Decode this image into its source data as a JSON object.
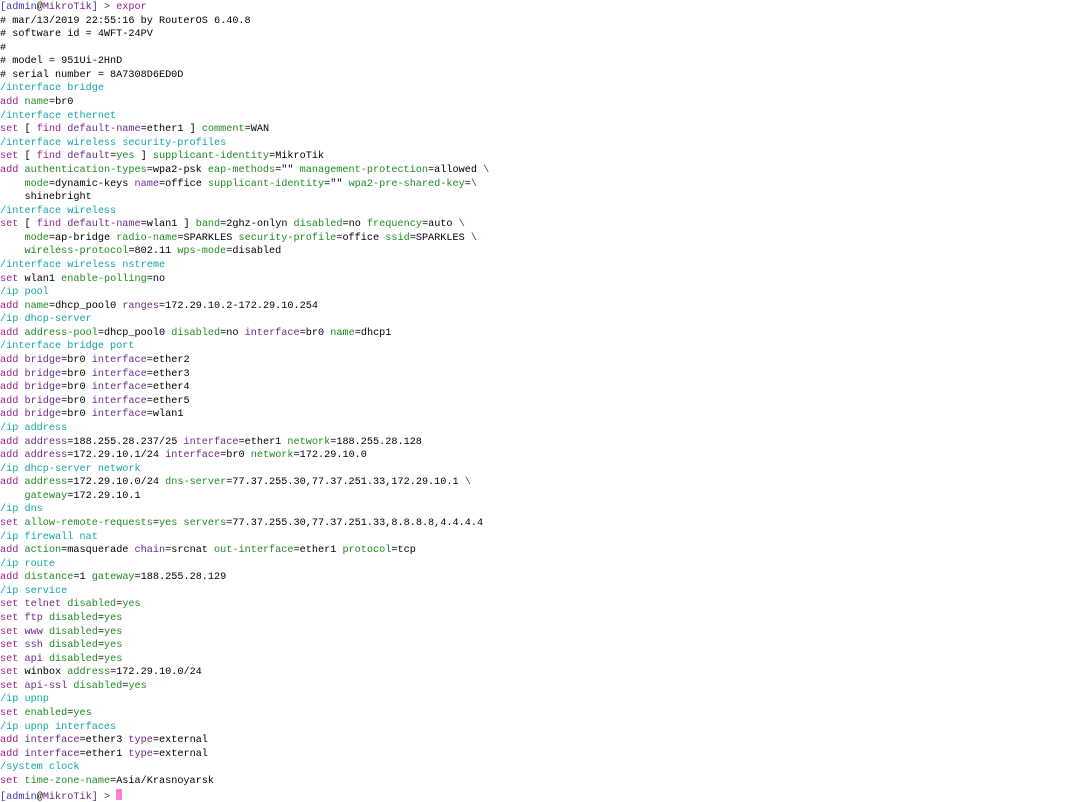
{
  "terminal": {
    "colors": {
      "default": "#000000",
      "prompt": "#3a3aa8",
      "identity": "#6b2a86",
      "path": "#15a5a5",
      "command": "#a0208a",
      "key": "#208a20",
      "keyword": "#6b2a86",
      "value": "#000000",
      "cursor": "#ff7fd0"
    },
    "lines": [
      [
        [
          "[admin",
          "prompt"
        ],
        [
          "@",
          "default"
        ],
        [
          "MikroTik",
          "identity"
        ],
        [
          "] > ",
          "prompt"
        ],
        [
          "expor",
          "command"
        ]
      ],
      [
        [
          "# mar/13/2019 22:55:16 by RouterOS 6.40.8",
          "default"
        ]
      ],
      [
        [
          "# software id = 4WFT-24PV",
          "default"
        ]
      ],
      [
        [
          "#",
          "default"
        ]
      ],
      [
        [
          "# model = 951Ui-2HnD",
          "default"
        ]
      ],
      [
        [
          "# serial number = 8A7308D6ED0D",
          "default"
        ]
      ],
      [
        [
          "/interface bridge",
          "path"
        ]
      ],
      [
        [
          "add ",
          "command"
        ],
        [
          "name",
          "key"
        ],
        [
          "=",
          "default"
        ],
        [
          "br0",
          "value"
        ]
      ],
      [
        [
          "/interface ethernet",
          "path"
        ]
      ],
      [
        [
          "set ",
          "command"
        ],
        [
          "[ ",
          "default"
        ],
        [
          "find ",
          "command"
        ],
        [
          "default-name",
          "keyword"
        ],
        [
          "=",
          "default"
        ],
        [
          "ether1",
          "value"
        ],
        [
          " ] ",
          "default"
        ],
        [
          "comment",
          "key"
        ],
        [
          "=",
          "default"
        ],
        [
          "WAN",
          "value"
        ]
      ],
      [
        [
          "/interface wireless security-profiles",
          "path"
        ]
      ],
      [
        [
          "set ",
          "command"
        ],
        [
          "[ ",
          "default"
        ],
        [
          "find ",
          "command"
        ],
        [
          "default",
          "keyword"
        ],
        [
          "=",
          "default"
        ],
        [
          "yes",
          "key"
        ],
        [
          " ] ",
          "default"
        ],
        [
          "supplicant-identity",
          "key"
        ],
        [
          "=",
          "default"
        ],
        [
          "MikroTik",
          "value"
        ]
      ],
      [
        [
          "add ",
          "command"
        ],
        [
          "authentication-types",
          "key"
        ],
        [
          "=",
          "default"
        ],
        [
          "wpa2-psk ",
          "value"
        ],
        [
          "eap-methods",
          "key"
        ],
        [
          "=\"\" ",
          "default"
        ],
        [
          "management-protection",
          "key"
        ],
        [
          "=",
          "default"
        ],
        [
          "allowed ",
          "value"
        ],
        [
          "\\",
          "keyword"
        ]
      ],
      [
        [
          "    mode",
          "key"
        ],
        [
          "=",
          "default"
        ],
        [
          "dynamic-keys ",
          "value"
        ],
        [
          "name",
          "keyword"
        ],
        [
          "=",
          "default"
        ],
        [
          "office ",
          "value"
        ],
        [
          "supplicant-identity",
          "key"
        ],
        [
          "=\"\" ",
          "default"
        ],
        [
          "wpa2-pre-shared-key",
          "key"
        ],
        [
          "=",
          "default"
        ],
        [
          "\\",
          "keyword"
        ]
      ],
      [
        [
          "    shinebright",
          "value"
        ]
      ],
      [
        [
          "/interface wireless",
          "path"
        ]
      ],
      [
        [
          "set ",
          "command"
        ],
        [
          "[ ",
          "default"
        ],
        [
          "find ",
          "command"
        ],
        [
          "default-name",
          "keyword"
        ],
        [
          "=",
          "default"
        ],
        [
          "wlan1",
          "value"
        ],
        [
          " ] ",
          "default"
        ],
        [
          "band",
          "key"
        ],
        [
          "=",
          "default"
        ],
        [
          "2ghz-onlyn ",
          "value"
        ],
        [
          "disabled",
          "key"
        ],
        [
          "=",
          "default"
        ],
        [
          "no ",
          "value"
        ],
        [
          "frequency",
          "key"
        ],
        [
          "=",
          "default"
        ],
        [
          "auto ",
          "value"
        ],
        [
          "\\",
          "keyword"
        ]
      ],
      [
        [
          "    mode",
          "key"
        ],
        [
          "=",
          "default"
        ],
        [
          "ap-bridge ",
          "value"
        ],
        [
          "radio-name",
          "key"
        ],
        [
          "=",
          "default"
        ],
        [
          "SPARKLES ",
          "value"
        ],
        [
          "security-profile",
          "key"
        ],
        [
          "=",
          "default"
        ],
        [
          "office ",
          "value"
        ],
        [
          "ssid",
          "key"
        ],
        [
          "=",
          "default"
        ],
        [
          "SPARKLES ",
          "value"
        ],
        [
          "\\",
          "keyword"
        ]
      ],
      [
        [
          "    wireless-protocol",
          "key"
        ],
        [
          "=",
          "default"
        ],
        [
          "802.11 ",
          "value"
        ],
        [
          "wps-mode",
          "key"
        ],
        [
          "=",
          "default"
        ],
        [
          "disabled",
          "value"
        ]
      ],
      [
        [
          "/interface wireless nstreme",
          "path"
        ]
      ],
      [
        [
          "set ",
          "command"
        ],
        [
          "wlan1 ",
          "value"
        ],
        [
          "enable-polling",
          "key"
        ],
        [
          "=",
          "default"
        ],
        [
          "no",
          "value"
        ]
      ],
      [
        [
          "/ip pool",
          "path"
        ]
      ],
      [
        [
          "add ",
          "command"
        ],
        [
          "name",
          "key"
        ],
        [
          "=",
          "default"
        ],
        [
          "dhcp_pool0 ",
          "value"
        ],
        [
          "ranges",
          "keyword"
        ],
        [
          "=",
          "default"
        ],
        [
          "172.29.10.2-172.29.10.254",
          "value"
        ]
      ],
      [
        [
          "/ip dhcp-server",
          "path"
        ]
      ],
      [
        [
          "add ",
          "command"
        ],
        [
          "address-pool",
          "key"
        ],
        [
          "=",
          "default"
        ],
        [
          "dhcp_pool0 ",
          "value"
        ],
        [
          "disabled",
          "key"
        ],
        [
          "=",
          "default"
        ],
        [
          "no ",
          "value"
        ],
        [
          "interface",
          "keyword"
        ],
        [
          "=",
          "default"
        ],
        [
          "br0 ",
          "value"
        ],
        [
          "name",
          "key"
        ],
        [
          "=",
          "default"
        ],
        [
          "dhcp1",
          "value"
        ]
      ],
      [
        [
          "/interface bridge port",
          "path"
        ]
      ],
      [
        [
          "add ",
          "command"
        ],
        [
          "bridge",
          "keyword"
        ],
        [
          "=",
          "default"
        ],
        [
          "br0 ",
          "value"
        ],
        [
          "interface",
          "keyword"
        ],
        [
          "=",
          "default"
        ],
        [
          "ether2",
          "value"
        ]
      ],
      [
        [
          "add ",
          "command"
        ],
        [
          "bridge",
          "keyword"
        ],
        [
          "=",
          "default"
        ],
        [
          "br0 ",
          "value"
        ],
        [
          "interface",
          "keyword"
        ],
        [
          "=",
          "default"
        ],
        [
          "ether3",
          "value"
        ]
      ],
      [
        [
          "add ",
          "command"
        ],
        [
          "bridge",
          "keyword"
        ],
        [
          "=",
          "default"
        ],
        [
          "br0 ",
          "value"
        ],
        [
          "interface",
          "keyword"
        ],
        [
          "=",
          "default"
        ],
        [
          "ether4",
          "value"
        ]
      ],
      [
        [
          "add ",
          "command"
        ],
        [
          "bridge",
          "keyword"
        ],
        [
          "=",
          "default"
        ],
        [
          "br0 ",
          "value"
        ],
        [
          "interface",
          "keyword"
        ],
        [
          "=",
          "default"
        ],
        [
          "ether5",
          "value"
        ]
      ],
      [
        [
          "add ",
          "command"
        ],
        [
          "bridge",
          "keyword"
        ],
        [
          "=",
          "default"
        ],
        [
          "br0 ",
          "value"
        ],
        [
          "interface",
          "keyword"
        ],
        [
          "=",
          "default"
        ],
        [
          "wlan1",
          "value"
        ]
      ],
      [
        [
          "/ip address",
          "path"
        ]
      ],
      [
        [
          "add ",
          "command"
        ],
        [
          "address",
          "keyword"
        ],
        [
          "=",
          "default"
        ],
        [
          "188.255.28.237",
          "value"
        ],
        [
          "/",
          "default"
        ],
        [
          "25 ",
          "value"
        ],
        [
          "interface",
          "keyword"
        ],
        [
          "=",
          "default"
        ],
        [
          "ether1 ",
          "value"
        ],
        [
          "network",
          "key"
        ],
        [
          "=",
          "default"
        ],
        [
          "188.255.28.128",
          "value"
        ]
      ],
      [
        [
          "add ",
          "command"
        ],
        [
          "address",
          "keyword"
        ],
        [
          "=",
          "default"
        ],
        [
          "172.29.10.1",
          "value"
        ],
        [
          "/",
          "default"
        ],
        [
          "24 ",
          "value"
        ],
        [
          "interface",
          "keyword"
        ],
        [
          "=",
          "default"
        ],
        [
          "br0 ",
          "value"
        ],
        [
          "network",
          "key"
        ],
        [
          "=",
          "default"
        ],
        [
          "172.29.10.0",
          "value"
        ]
      ],
      [
        [
          "/ip dhcp-server network",
          "path"
        ]
      ],
      [
        [
          "add ",
          "command"
        ],
        [
          "address",
          "key"
        ],
        [
          "=",
          "default"
        ],
        [
          "172.29.10.0",
          "value"
        ],
        [
          "/",
          "default"
        ],
        [
          "24 ",
          "value"
        ],
        [
          "dns-server",
          "key"
        ],
        [
          "=",
          "default"
        ],
        [
          "77.37.255.30",
          "value"
        ],
        [
          ",",
          "default"
        ],
        [
          "77.37.251.33",
          "value"
        ],
        [
          ",",
          "default"
        ],
        [
          "172.29.10.1 ",
          "value"
        ],
        [
          "\\",
          "keyword"
        ]
      ],
      [
        [
          "    gateway",
          "key"
        ],
        [
          "=",
          "default"
        ],
        [
          "172.29.10.1",
          "value"
        ]
      ],
      [
        [
          "/ip dns",
          "path"
        ]
      ],
      [
        [
          "set ",
          "command"
        ],
        [
          "allow-remote-requests",
          "key"
        ],
        [
          "=",
          "default"
        ],
        [
          "yes ",
          "key"
        ],
        [
          "servers",
          "key"
        ],
        [
          "=",
          "default"
        ],
        [
          "77.37.255.30",
          "value"
        ],
        [
          ",",
          "default"
        ],
        [
          "77.37.251.33",
          "value"
        ],
        [
          ",",
          "default"
        ],
        [
          "8.8.8.8",
          "value"
        ],
        [
          ",",
          "default"
        ],
        [
          "4.4.4.4",
          "value"
        ]
      ],
      [
        [
          "/ip firewall nat",
          "path"
        ]
      ],
      [
        [
          "add ",
          "command"
        ],
        [
          "action",
          "key"
        ],
        [
          "=",
          "default"
        ],
        [
          "masquerade ",
          "value"
        ],
        [
          "chain",
          "keyword"
        ],
        [
          "=",
          "default"
        ],
        [
          "srcnat ",
          "value"
        ],
        [
          "out-interface",
          "key"
        ],
        [
          "=",
          "default"
        ],
        [
          "ether1 ",
          "value"
        ],
        [
          "protocol",
          "key"
        ],
        [
          "=",
          "default"
        ],
        [
          "tcp",
          "value"
        ]
      ],
      [
        [
          "/ip route",
          "path"
        ]
      ],
      [
        [
          "add ",
          "command"
        ],
        [
          "distance",
          "key"
        ],
        [
          "=",
          "default"
        ],
        [
          "1 ",
          "value"
        ],
        [
          "gateway",
          "key"
        ],
        [
          "=",
          "default"
        ],
        [
          "188.255.28.129",
          "value"
        ]
      ],
      [
        [
          "/ip service",
          "path"
        ]
      ],
      [
        [
          "set ",
          "command"
        ],
        [
          "telnet ",
          "keyword"
        ],
        [
          "disabled",
          "key"
        ],
        [
          "=",
          "default"
        ],
        [
          "yes",
          "key"
        ]
      ],
      [
        [
          "set ",
          "command"
        ],
        [
          "ftp ",
          "keyword"
        ],
        [
          "disabled",
          "key"
        ],
        [
          "=",
          "default"
        ],
        [
          "yes",
          "key"
        ]
      ],
      [
        [
          "set ",
          "command"
        ],
        [
          "www ",
          "keyword"
        ],
        [
          "disabled",
          "key"
        ],
        [
          "=",
          "default"
        ],
        [
          "yes",
          "key"
        ]
      ],
      [
        [
          "set ",
          "command"
        ],
        [
          "ssh ",
          "keyword"
        ],
        [
          "disabled",
          "key"
        ],
        [
          "=",
          "default"
        ],
        [
          "yes",
          "key"
        ]
      ],
      [
        [
          "set ",
          "command"
        ],
        [
          "api ",
          "keyword"
        ],
        [
          "disabled",
          "key"
        ],
        [
          "=",
          "default"
        ],
        [
          "yes",
          "key"
        ]
      ],
      [
        [
          "set ",
          "command"
        ],
        [
          "winbox ",
          "value"
        ],
        [
          "address",
          "key"
        ],
        [
          "=",
          "default"
        ],
        [
          "172.29.10.0",
          "value"
        ],
        [
          "/",
          "default"
        ],
        [
          "24",
          "value"
        ]
      ],
      [
        [
          "set ",
          "command"
        ],
        [
          "api-ssl ",
          "keyword"
        ],
        [
          "disabled",
          "key"
        ],
        [
          "=",
          "default"
        ],
        [
          "yes",
          "key"
        ]
      ],
      [
        [
          "/ip upnp",
          "path"
        ]
      ],
      [
        [
          "set ",
          "command"
        ],
        [
          "enabled",
          "key"
        ],
        [
          "=",
          "default"
        ],
        [
          "yes",
          "key"
        ]
      ],
      [
        [
          "/ip upnp interfaces",
          "path"
        ]
      ],
      [
        [
          "add ",
          "command"
        ],
        [
          "interface",
          "keyword"
        ],
        [
          "=",
          "default"
        ],
        [
          "ether3 ",
          "value"
        ],
        [
          "type",
          "keyword"
        ],
        [
          "=",
          "default"
        ],
        [
          "external",
          "value"
        ]
      ],
      [
        [
          "add ",
          "command"
        ],
        [
          "interface",
          "keyword"
        ],
        [
          "=",
          "default"
        ],
        [
          "ether1 ",
          "value"
        ],
        [
          "type",
          "keyword"
        ],
        [
          "=",
          "default"
        ],
        [
          "external",
          "value"
        ]
      ],
      [
        [
          "/system clock",
          "path"
        ]
      ],
      [
        [
          "set ",
          "command"
        ],
        [
          "time-zone-name",
          "key"
        ],
        [
          "=",
          "default"
        ],
        [
          "Asia/Krasnoyarsk",
          "value"
        ]
      ],
      [
        [
          "[admin",
          "prompt"
        ],
        [
          "@",
          "default"
        ],
        [
          "MikroTik",
          "identity"
        ],
        [
          "] > ",
          "prompt"
        ]
      ]
    ]
  }
}
